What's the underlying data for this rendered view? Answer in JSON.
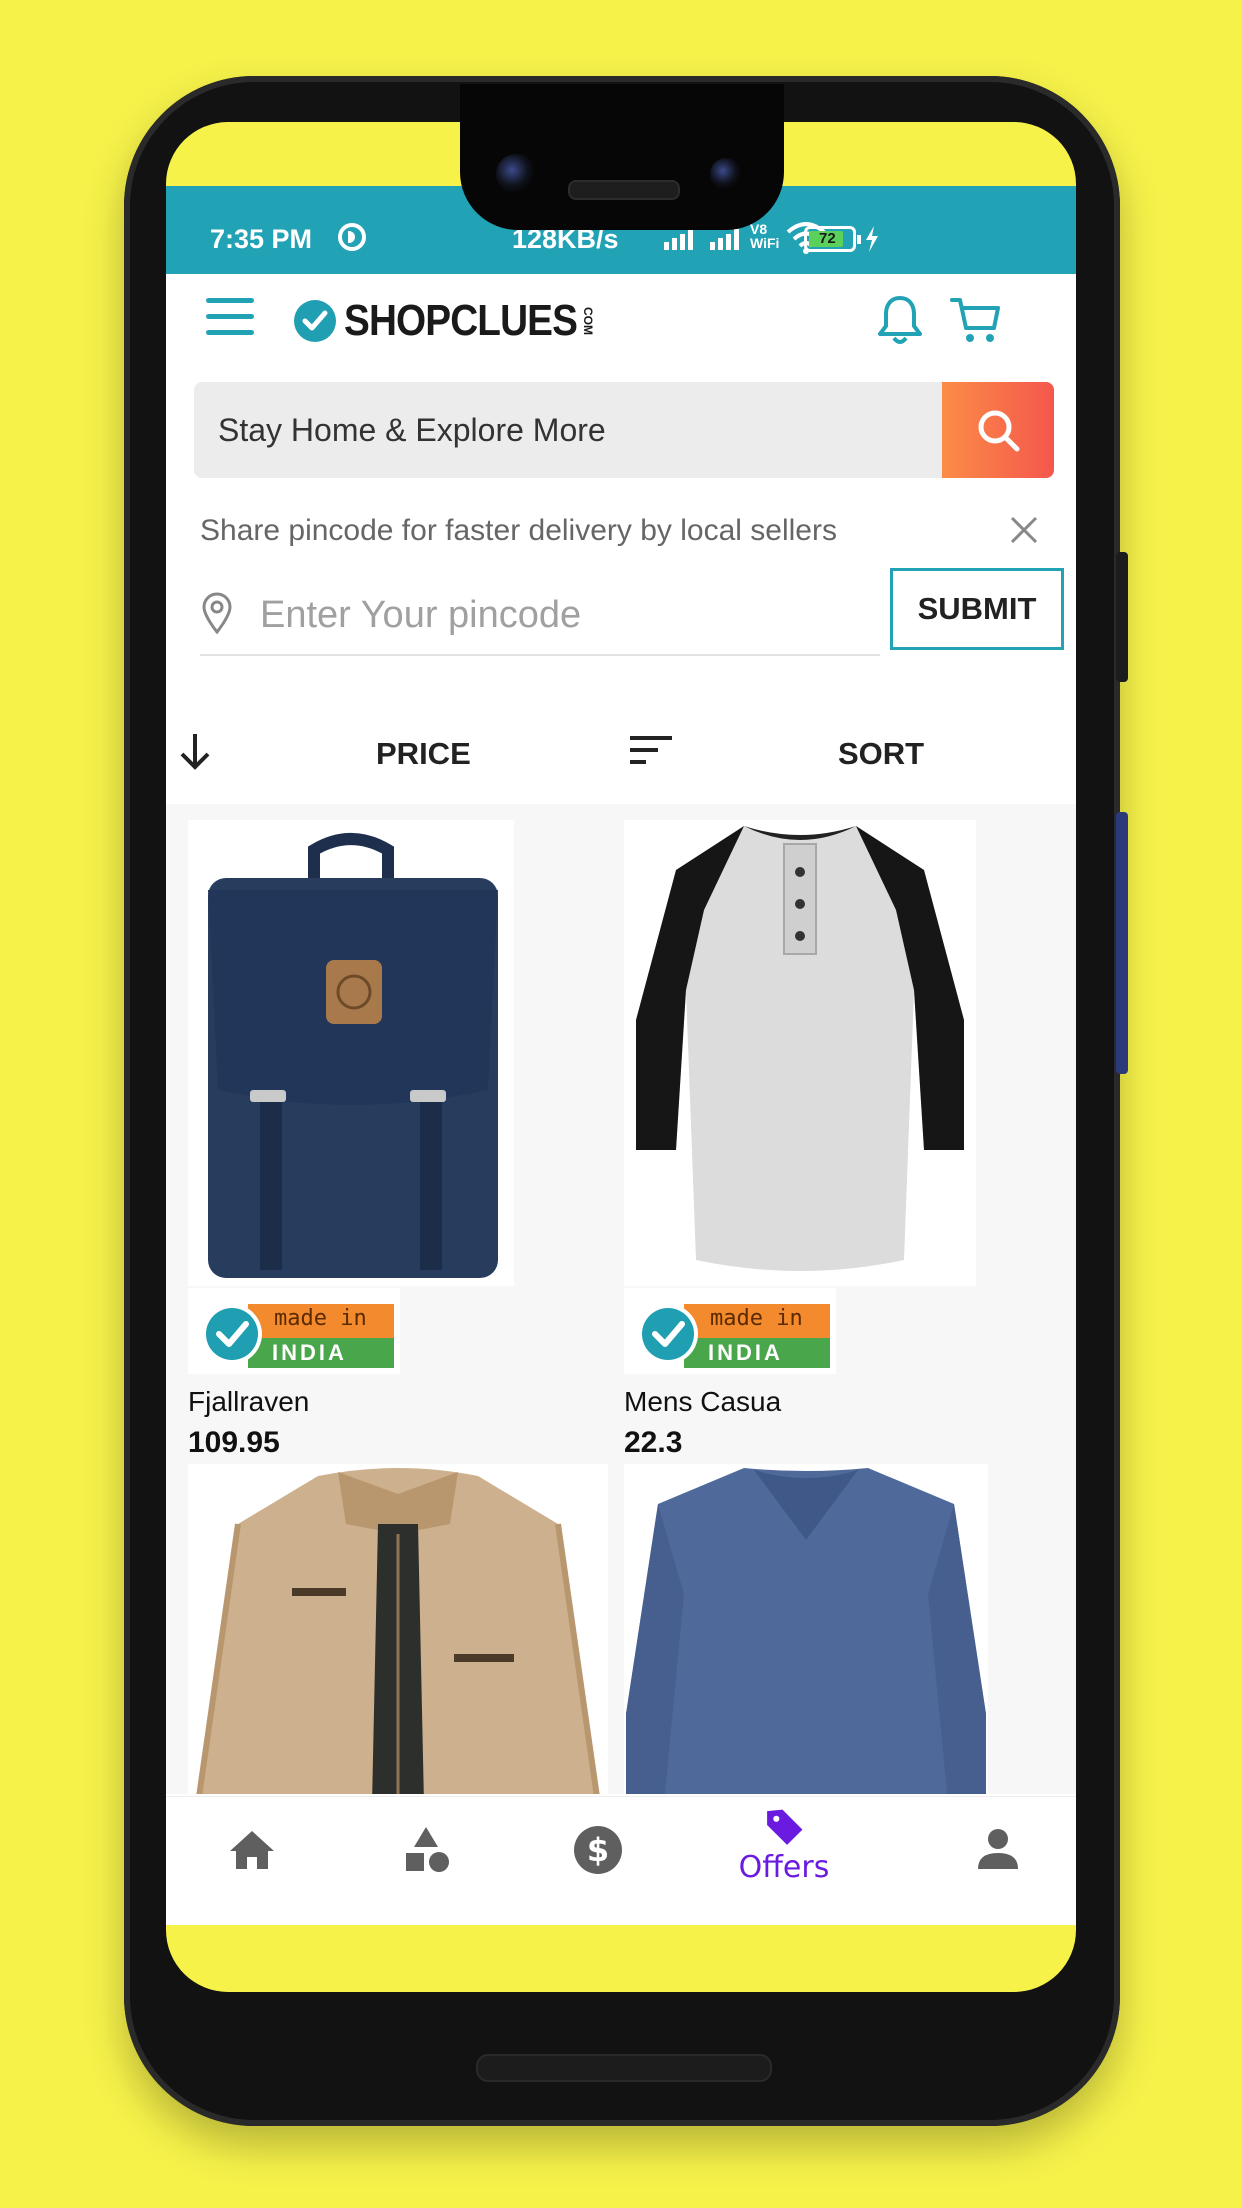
{
  "status": {
    "time": "7:35 PM",
    "network_speed": "128KB/s",
    "battery": "72",
    "icons": [
      "data-saver-icon",
      "signal-icon",
      "signal-icon",
      "vowifi-icon",
      "wifi-icon",
      "battery-icon",
      "charging-icon"
    ]
  },
  "header": {
    "brand": "SHOPCLUES",
    "brand_suffix": "COM",
    "icons": [
      "menu-icon",
      "bell-icon",
      "cart-icon"
    ]
  },
  "search": {
    "placeholder": "Stay Home & Explore More",
    "icon": "search-icon"
  },
  "pincode": {
    "message": "Share pincode for faster delivery by local sellers",
    "placeholder": "Enter Your pincode",
    "submit_label": "SUBMIT"
  },
  "filters": {
    "price_label": "PRICE",
    "sort_label": "SORT"
  },
  "products": [
    {
      "name": "Fjallraven",
      "price": "109.95",
      "badge_top": "made in",
      "badge_bottom": "INDIA"
    },
    {
      "name": "Mens Casua",
      "price": "22.3",
      "badge_top": "made in",
      "badge_bottom": "INDIA"
    },
    {
      "name": "",
      "price": ""
    },
    {
      "name": "",
      "price": ""
    }
  ],
  "bottom_nav": {
    "active_label": "Offers",
    "items": [
      "home-icon",
      "categories-icon",
      "dollar-icon",
      "offers-tag-icon",
      "profile-icon"
    ]
  },
  "colors": {
    "accent": "#22a2b5",
    "offers_active": "#6a1bdf",
    "search_button": "#f4574d",
    "background": "#f6f24a"
  }
}
